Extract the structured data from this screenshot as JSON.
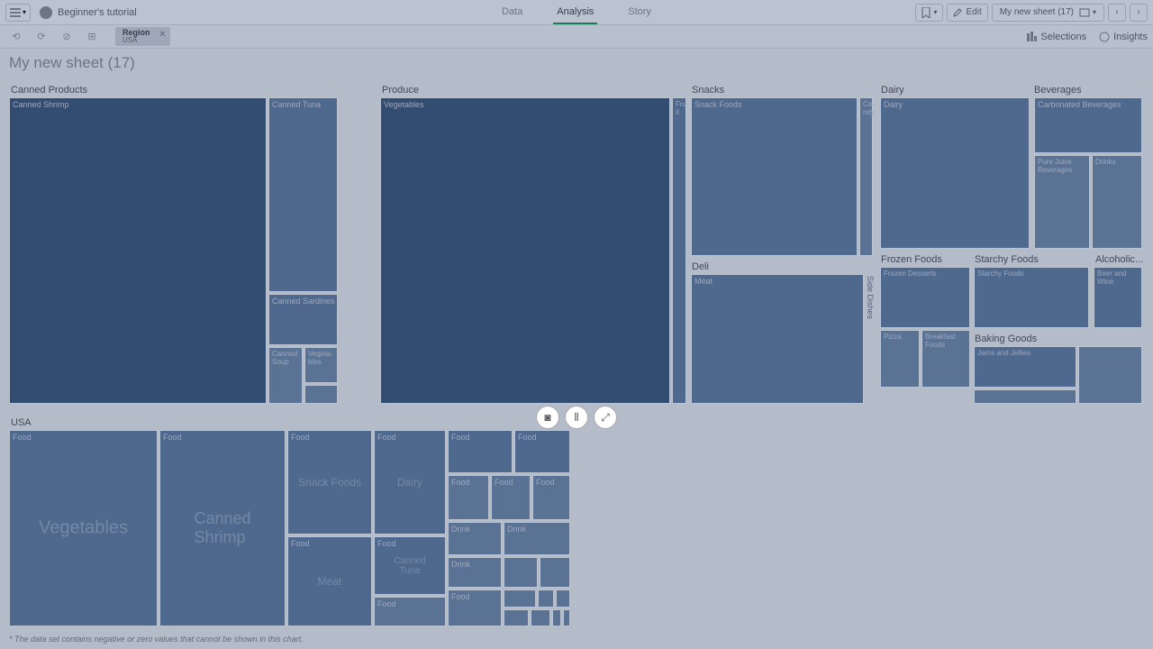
{
  "topbar": {
    "title": "Beginner's tutorial",
    "tabs": {
      "data": "Data",
      "analysis": "Analysis",
      "story": "Story"
    },
    "edit": "Edit",
    "sheet": "My new sheet (17)"
  },
  "selbar": {
    "chip": {
      "label": "Region",
      "value": "USA"
    },
    "selections": "Selections",
    "insights": "Insights"
  },
  "sheet_title": "My new sheet (17)",
  "groups": {
    "canned": "Canned Products",
    "produce": "Produce",
    "snacks": "Snacks",
    "dairy": "Dairy",
    "beverages": "Beverages",
    "deli": "Deli",
    "frozen": "Frozen Foods",
    "starchy": "Starchy Foods",
    "alcoholic": "Alcoholic...",
    "baking": "Baking Goods",
    "usa": "USA"
  },
  "cells": {
    "canned_shrimp": "Canned Shrimp",
    "canned_tuna": "Canned Tuna",
    "canned_sardines": "Canned Sardines",
    "canned_soup": "Canned Soup",
    "vegeta": "Vegeta-bles",
    "vegetables": "Vegetables",
    "fruit": "Fru-it",
    "snack_foods": "Snack Foods",
    "candy": "Ca-ndy",
    "side_dishes": "Side Dishes",
    "meat": "Meat",
    "dairy_l": "Dairy",
    "carbonated": "Carbonated Beverages",
    "pure_juice": "Pure Juice Beverages",
    "drinks": "Drinks",
    "frozen_desserts": "Frozen Desserts",
    "pizza": "Pizza",
    "breakfast": "Breakfast Foods",
    "starchy_foods": "Starchy Foods",
    "beer_wine": "Beer and Wine",
    "jams": "Jams and Jellies",
    "food": "Food",
    "drink": "Drink",
    "big_veg": "Vegetables",
    "big_shrimp": "Canned\nShrimp",
    "mid_snack": "Snack Foods",
    "mid_dairy": "Dairy",
    "mid_meat": "Meat",
    "mid_tuna": "Canned\nTuna"
  },
  "footnote": "* The data set contains negative or zero values that cannot be shown in this chart."
}
